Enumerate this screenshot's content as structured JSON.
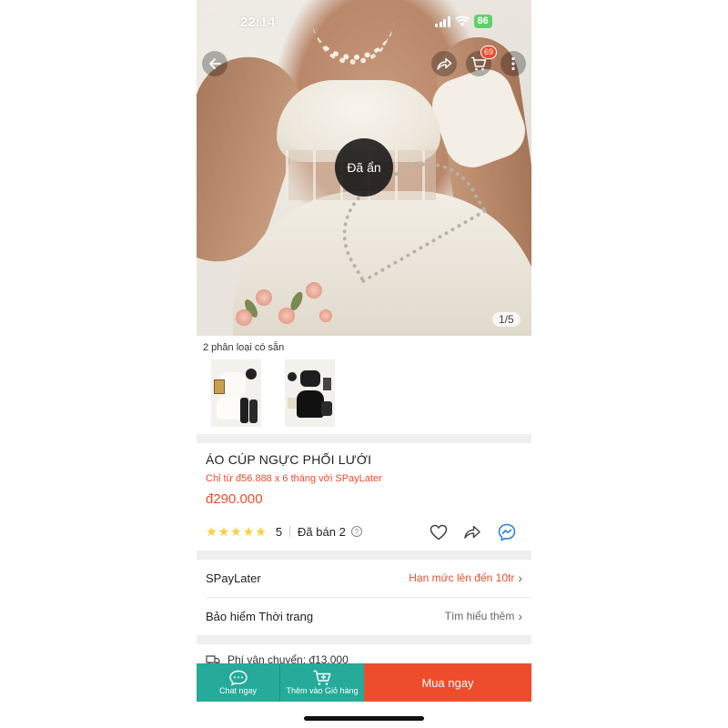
{
  "status_bar": {
    "time": "22:14",
    "battery": "86"
  },
  "hero": {
    "hidden_label": "Đã ẩn",
    "counter": "1/5",
    "cart_count": "69"
  },
  "variants": {
    "label": "2 phân loại có sẵn"
  },
  "product": {
    "title": "ÁO CÚP NGỰC PHỐI LƯỚI",
    "installment": "Chỉ từ đ56.888 x 6 tháng với SPayLater",
    "price": "đ290.000",
    "rating": "5",
    "sold": "Đã bán 2",
    "help_symbol": "?"
  },
  "rows": {
    "spaylater": {
      "label": "SPayLater",
      "value": "Hạn mức lên đến 10tr"
    },
    "insurance": {
      "label": "Bảo hiểm Thời trang",
      "value": "Tìm hiểu thêm"
    },
    "shipping": {
      "label": "Phí vận chuyển: đ13.000"
    }
  },
  "bottom_bar": {
    "chat": "Chat ngay",
    "add_to_cart": "Thêm vào Giỏ hàng",
    "buy_now": "Mua ngay"
  },
  "colors": {
    "accent": "#ee4d2d",
    "teal": "#26aa99",
    "star": "#ffce3d",
    "battery": "#5fd16a"
  },
  "icons": [
    "back-arrow-icon",
    "share-icon",
    "cart-icon",
    "more-icon",
    "star-icon",
    "help-icon",
    "heart-icon",
    "messenger-icon",
    "chevron-right-icon",
    "truck-icon",
    "chat-icon",
    "add-cart-icon"
  ]
}
